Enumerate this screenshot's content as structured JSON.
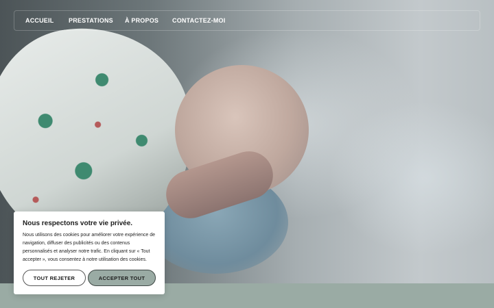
{
  "nav": {
    "items": [
      {
        "label": "ACCUEIL"
      },
      {
        "label": "PRESTATIONS"
      },
      {
        "label": "À PROPOS"
      },
      {
        "label": "CONTACTEZ-MOI"
      }
    ]
  },
  "hero": {
    "image_subject": "newborn-bath-photo"
  },
  "cookie": {
    "title": "Nous respectons votre vie privée.",
    "body": "Nous utilisons des cookies pour améliorer votre expérience de navigation, diffuser des publicités ou des contenus personnalisés et analyser notre trafic. En cliquant sur « Tout accepter », vous consentez à notre utilisation des cookies.",
    "reject_label": "TOUT REJETER",
    "accept_label": "ACCEPTER TOUT"
  },
  "colors": {
    "accent": "#9aaba4",
    "banner_bg": "#ffffff",
    "text": "#1c1c1c"
  }
}
